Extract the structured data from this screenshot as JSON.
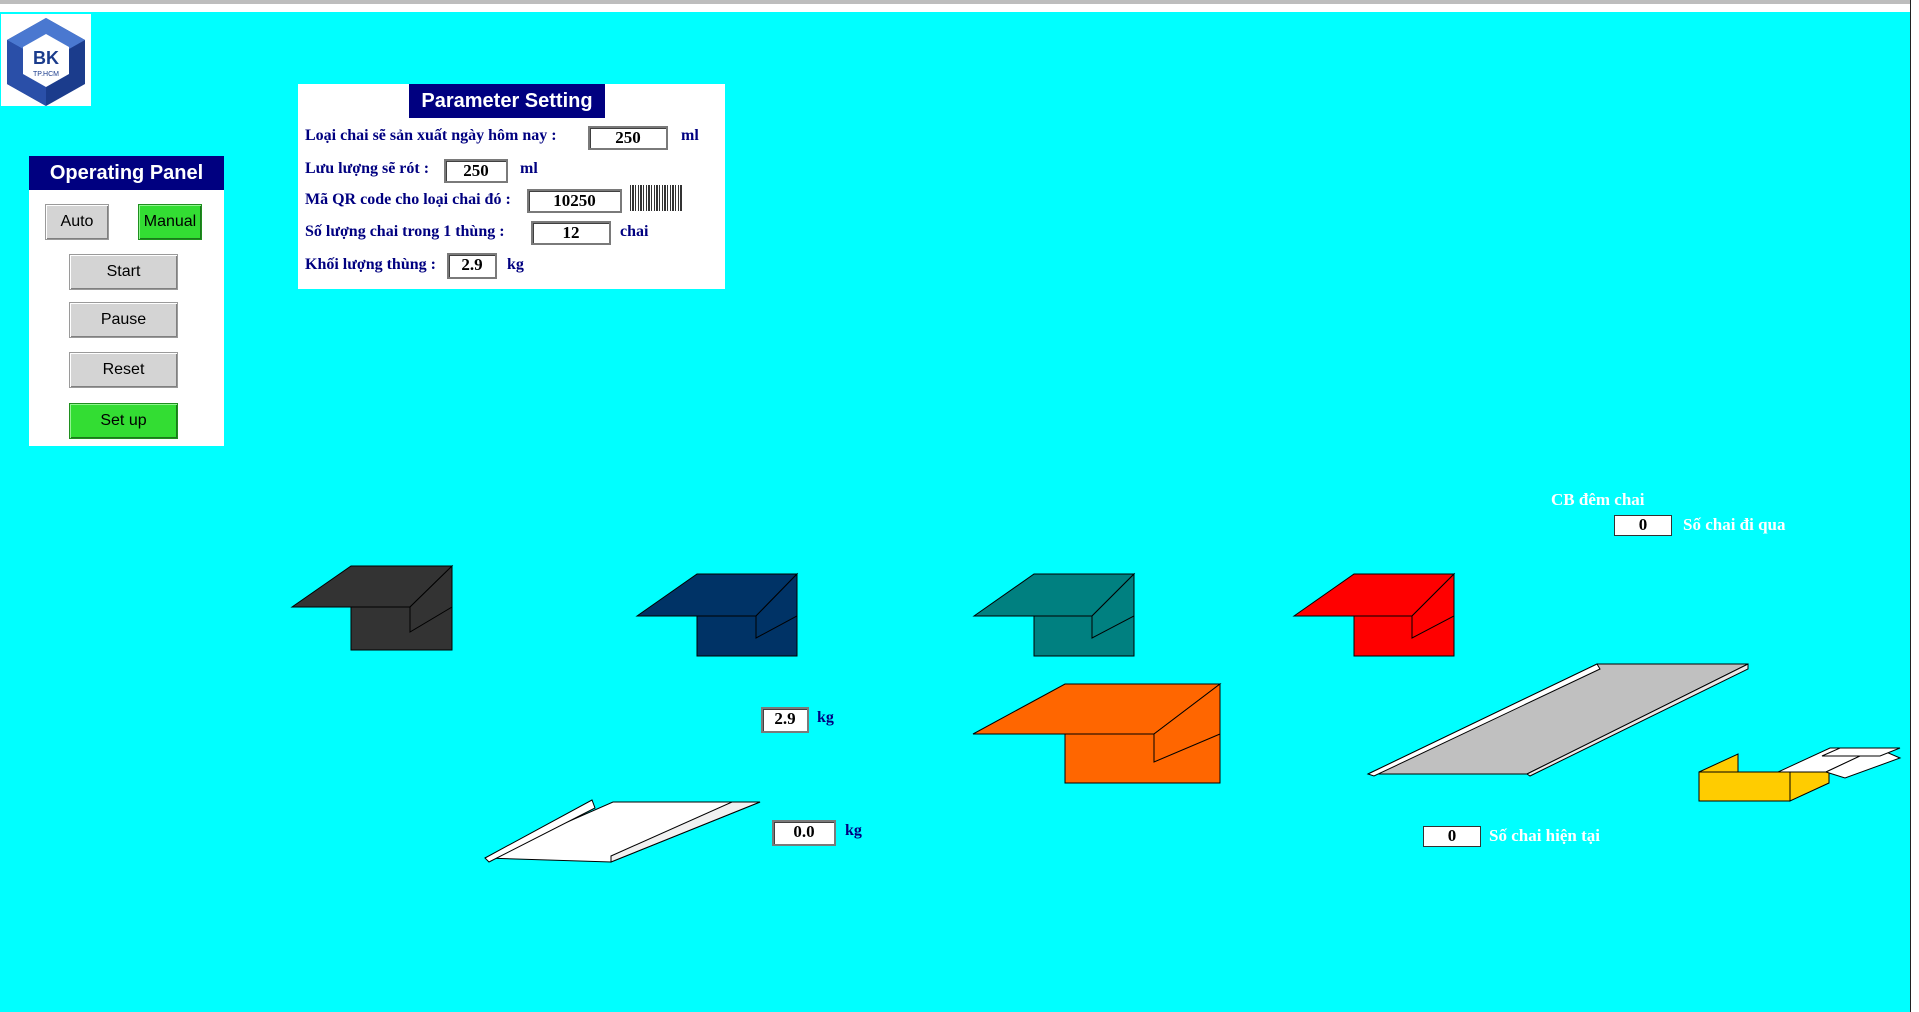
{
  "logo": {
    "text": "BK",
    "subtext": "TP.HCM"
  },
  "operating_panel": {
    "title": "Operating Panel",
    "buttons": {
      "auto": "Auto",
      "manual": "Manual",
      "start": "Start",
      "pause": "Pause",
      "reset": "Reset",
      "setup": "Set up"
    }
  },
  "parameter_setting": {
    "title": "Parameter Setting",
    "bottle_type": {
      "label": "Loại chai sẽ sản xuất ngày hôm nay :",
      "value": "250",
      "unit": "ml"
    },
    "flow": {
      "label": "Lưu lượng sẽ rót :",
      "value": "250",
      "unit": "ml"
    },
    "qr_code": {
      "label": "Mã QR code cho loại chai đó :",
      "value": "10250"
    },
    "bottles_per_box": {
      "label": "Số lượng chai trong 1 thùng :",
      "value": "12",
      "unit": "chai"
    },
    "box_weight": {
      "label": "Khối lượng thùng :",
      "value": "2.9",
      "unit": "kg"
    }
  },
  "sensor": {
    "label": "CB đêm chai",
    "passed_value": "0",
    "passed_label": "Số chai đi qua"
  },
  "current_count": {
    "value": "0",
    "label": "Số chai hiện tại"
  },
  "weight_display_1": {
    "value": "2.9",
    "unit": "kg"
  },
  "weight_display_2": {
    "value": "0.0",
    "unit": "kg"
  },
  "colors": {
    "background": "#00ffff",
    "panel_title": "#000080",
    "active_button": "#33dd33",
    "tank_black": "#333333",
    "tank_navy": "#003366",
    "tank_teal": "#008080",
    "tank_red": "#ff0000",
    "tank_orange": "#ff6600",
    "conveyor": "#c0c0c0",
    "box_yellow": "#ffcc00"
  }
}
